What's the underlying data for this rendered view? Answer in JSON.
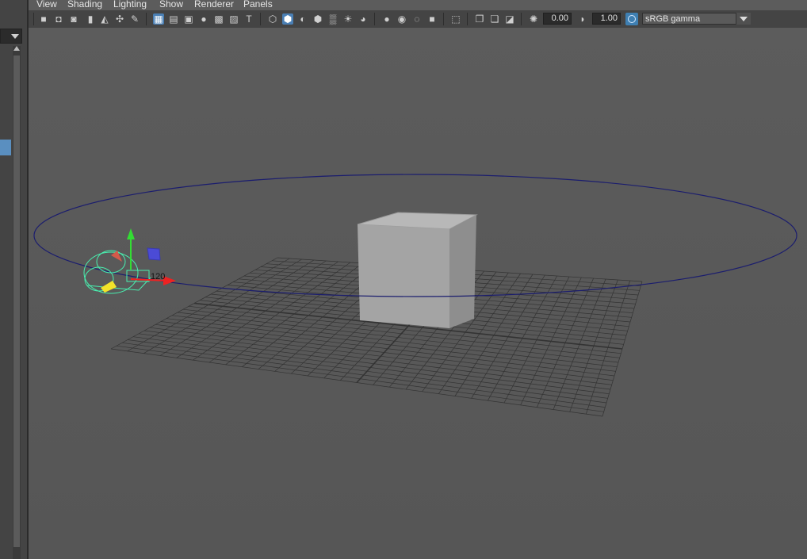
{
  "menu": {
    "items": [
      "View",
      "Shading",
      "Lighting",
      "Show",
      "Renderer",
      "Panels"
    ]
  },
  "toolbar": {
    "icons": [
      "select-camera-icon",
      "camera-attributes-icon",
      "bookmark-icon",
      "image-plane-icon",
      "2d-pan-zoom-icon",
      "grease-pencil-icon",
      "grid-icon",
      "film-gate-icon",
      "resolution-gate-icon",
      "gate-mask-icon",
      "field-chart-icon",
      "safe-action-icon",
      "safe-title-icon",
      "wireframe-icon",
      "smooth-shade-icon",
      "default-material-icon",
      "textured-icon",
      "use-all-lights-icon",
      "shadows-icon",
      "screen-space-ao-icon",
      "motion-blur-icon",
      "anti-aliasing-icon",
      "depth-of-field-icon",
      "isolate-select-icon",
      "xray-icon",
      "xray-active-components-icon",
      "xray-joints-icon",
      "exposure-icon",
      "gamma-icon",
      "color-management-icon"
    ],
    "exposure_value": "0.00",
    "gamma_value": "1.00",
    "view_transform": "sRGB gamma"
  },
  "scene": {
    "objects": [
      "polygon-cube",
      "nurbs-circle-motion-path",
      "camera-with-manipulator",
      "ground-grid"
    ],
    "frame_label": "120",
    "colors": {
      "background": "#5a5a5a",
      "grid": "#333333",
      "cube_front": "#a3a3a3",
      "cube_top": "#b7b7b7",
      "cube_side": "#8f8f8f",
      "circle": "#1b1d6e",
      "camera_wire": "#49f0b0"
    }
  }
}
